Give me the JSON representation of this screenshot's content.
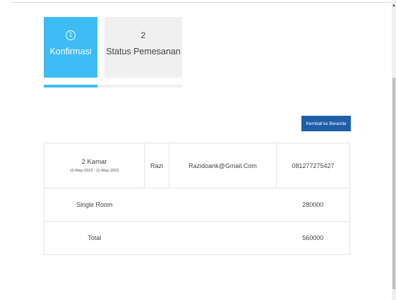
{
  "steps": [
    {
      "number": "1",
      "label": "Konfirmasi",
      "active": true
    },
    {
      "number": "2",
      "label": "Status Pemesanan",
      "active": false
    }
  ],
  "progress": {
    "fraction": 0.39
  },
  "back_button": {
    "label": "Kembali ke Beranda"
  },
  "booking": {
    "rooms": "2 Kamar",
    "dates": "10-May-2023 - 11-May-2023",
    "name": "Razi",
    "email": "Razidoank@Gmail.Com",
    "phone": "081277275427"
  },
  "room_line": {
    "room_type": "Single Room",
    "price": "280000"
  },
  "total_line": {
    "label": "Total",
    "amount": "560000"
  },
  "colors": {
    "accent": "#3dbcf5",
    "button": "#1f5ea9",
    "inactive": "#f0f0f0"
  },
  "scrollbar": {
    "arrow_icon": "triangle-up"
  }
}
